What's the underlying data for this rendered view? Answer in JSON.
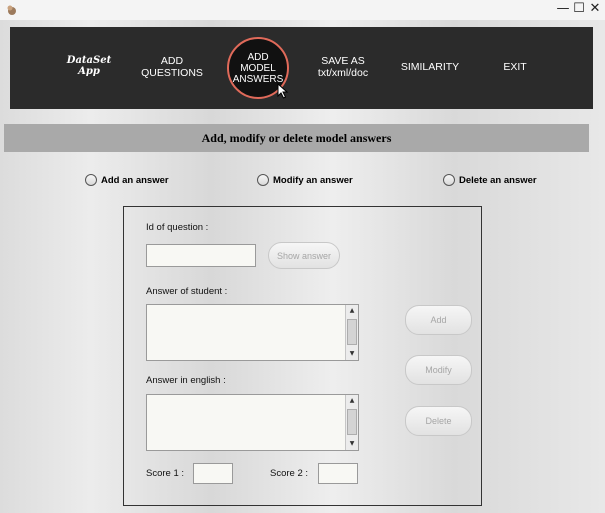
{
  "window": {
    "minimize": "—",
    "maximize": "☐",
    "close": "✕"
  },
  "nav": {
    "logo": "DataSet\nApp",
    "add_questions": "ADD\nQUESTIONS",
    "add_model_answers": "ADD\nMODEL\nANSWERS",
    "save_as": "SAVE AS\ntxt/xml/doc",
    "similarity": "SIMILARITY",
    "exit": "EXIT",
    "active_border_color": "#e06a5a"
  },
  "section": {
    "title": "Add, modify or delete model answers"
  },
  "mode": {
    "add_answer": "Add an answer",
    "modify_answer": "Modify an answer",
    "delete_answer": "Delete an answer"
  },
  "form": {
    "id_label": "Id of question :",
    "id_value": "",
    "show_answer_button": "Show answer",
    "student_answer_label": "Answer of student :",
    "student_answer_value": "",
    "english_answer_label": "Answer in english :",
    "english_answer_value": "",
    "score1_label": "Score 1 :",
    "score1_value": "",
    "score2_label": "Score 2  :",
    "score2_value": ""
  },
  "actions": {
    "add": "Add",
    "modify": "Modify",
    "delete": "Delete"
  }
}
